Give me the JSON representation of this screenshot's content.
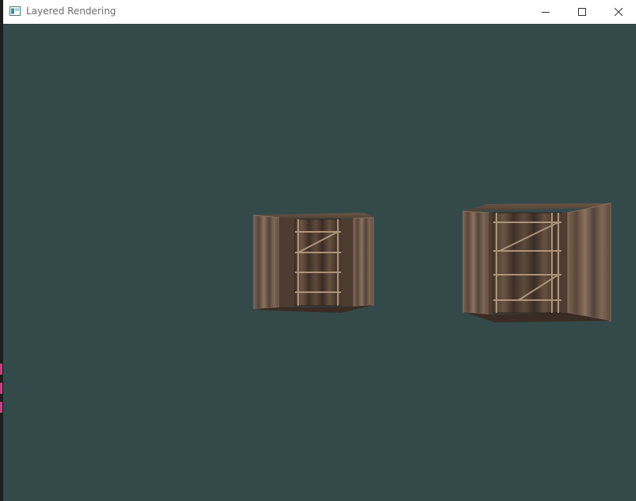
{
  "window": {
    "title": "Layered Rendering",
    "controls": {
      "minimize": "minimize",
      "maximize": "maximize",
      "close": "close"
    }
  },
  "viewport": {
    "clear_color": "#344a4a",
    "objects": [
      "wooden-crate",
      "wooden-crate"
    ]
  },
  "colors": {
    "crate_wood_dark": "#3e2f26",
    "crate_wood_mid": "#5b463a",
    "crate_wood_light": "#8a6e5a",
    "crate_plank_highlight": "#b89c80"
  }
}
